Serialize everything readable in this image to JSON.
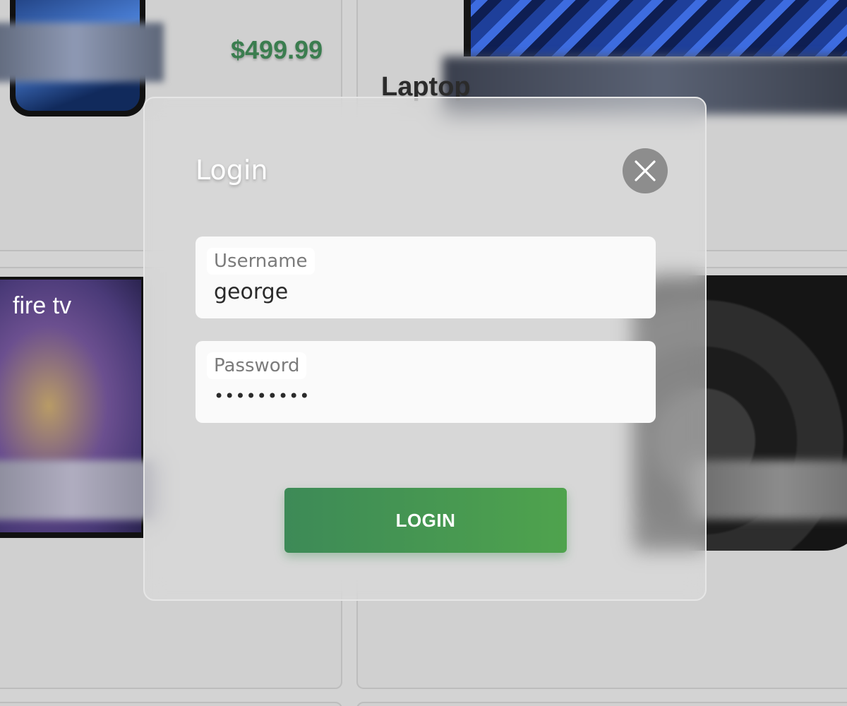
{
  "background": {
    "phone_card": {
      "price": "$499.99"
    },
    "laptop_card": {
      "name": "Laptop"
    },
    "tv_card": {
      "brand_logo": "fire tv"
    }
  },
  "modal": {
    "title": "Login",
    "close_icon": "close-icon",
    "username": {
      "label": "Username",
      "value": "george"
    },
    "password": {
      "label": "Password",
      "value": "•••••••••"
    },
    "login_label": "LOGIN"
  },
  "colors": {
    "accent_green": "#3b7d4f",
    "button_green": "#4a9e52",
    "close_grey": "#8d8d8d"
  }
}
